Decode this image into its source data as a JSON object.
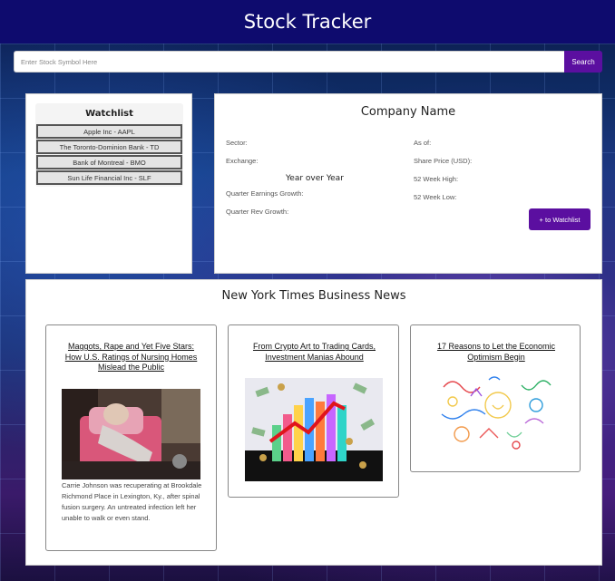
{
  "header": {
    "title": "Stock Tracker"
  },
  "search": {
    "placeholder": "Enter Stock Symbol Here",
    "button_label": "Search"
  },
  "watchlist": {
    "title": "Watchlist",
    "items": [
      "Apple Inc - AAPL",
      "The Toronto-Dominion Bank - TD",
      "Bank of Montreal - BMO",
      "Sun Life Financial Inc - SLF"
    ]
  },
  "company": {
    "name": "Company Name",
    "sector_label": "Sector:",
    "exchange_label": "Exchange:",
    "yoy_heading": "Year over Year",
    "quarter_earnings_label": "Quarter Earnings Growth:",
    "quarter_rev_label": "Quarter Rev Growth:",
    "as_of_label": "As of:",
    "share_price_label": "Share Price (USD):",
    "week52_high_label": "52 Week High:",
    "week52_low_label": "52 Week Low:",
    "add_button_label": "+ to Watchlist"
  },
  "news": {
    "title": "New York Times Business News",
    "articles": [
      {
        "headline": "Maggots, Rape and Yet Five Stars: How U.S. Ratings of Nursing Homes Mislead the Public",
        "summary": "Carrie Johnson was recuperating at Brookdale Richmond Place in Lexington, Ky., after spinal fusion surgery. An untreated infection left her unable to walk or even stand."
      },
      {
        "headline": "From Crypto Art to Trading Cards, Investment Manias Abound",
        "summary": ""
      },
      {
        "headline": "17 Reasons to Let the Economic Optimism Begin",
        "summary": ""
      }
    ]
  },
  "colors": {
    "header_bg": "#0e0b6e",
    "accent": "#5b0fa0"
  }
}
